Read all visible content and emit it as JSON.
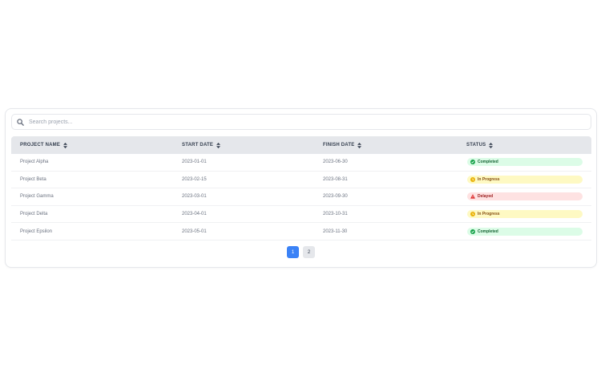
{
  "search": {
    "placeholder": "Search projects...",
    "value": ""
  },
  "table": {
    "columns": [
      "PROJECT NAME",
      "START DATE",
      "FINISH DATE",
      "STATUS"
    ],
    "rows": [
      {
        "name": "Project Alpha",
        "start": "2023-01-01",
        "finish": "2023-06-30",
        "status": "Completed"
      },
      {
        "name": "Project Beta",
        "start": "2023-02-15",
        "finish": "2023-08-31",
        "status": "In Progress"
      },
      {
        "name": "Project Gamma",
        "start": "2023-03-01",
        "finish": "2023-09-30",
        "status": "Delayed"
      },
      {
        "name": "Project Delta",
        "start": "2023-04-01",
        "finish": "2023-10-31",
        "status": "In Progress"
      },
      {
        "name": "Project Epsilon",
        "start": "2023-05-01",
        "finish": "2023-11-30",
        "status": "Completed"
      }
    ]
  },
  "status_colors": {
    "Completed": {
      "bg": "#dcfce7",
      "fg": "#16a34a",
      "icon": "check-circle-icon"
    },
    "In Progress": {
      "bg": "#fef9c3",
      "fg": "#eab308",
      "icon": "clock-icon"
    },
    "Delayed": {
      "bg": "#fee2e2",
      "fg": "#dc2626",
      "icon": "warning-triangle-icon"
    }
  },
  "pagination": {
    "pages": [
      "1",
      "2"
    ],
    "current": "1"
  },
  "colors": {
    "accent": "#3b82f6",
    "header_bg": "#e5e7eb"
  }
}
